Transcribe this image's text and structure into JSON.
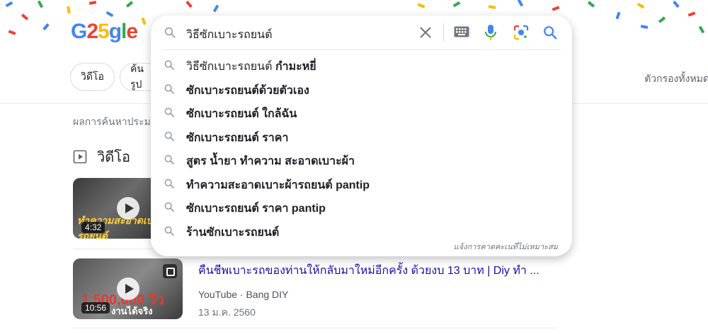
{
  "logo": {
    "text": "G25gle"
  },
  "search": {
    "query": "วิธีซักเบาะรถยนต์",
    "suggestions": [
      {
        "plain": "วิธีซักเบาะรถยนต์ ",
        "bold": "กำมะหยี่"
      },
      {
        "plain": "",
        "bold": "ซักเบาะรถยนต์ด้วยตัวเอง"
      },
      {
        "plain": "",
        "bold": "ซักเบาะรถยนต์ ใกล้ฉัน"
      },
      {
        "plain": "",
        "bold": "ซักเบาะรถยนต์ ราคา"
      },
      {
        "plain": "",
        "bold": "สูตร น้ำยา ทำความ สะอาดเบาะผ้า"
      },
      {
        "plain": "",
        "bold": "ทำความสะอาดเบาะผ้ารถยนต์ pantip"
      },
      {
        "plain": "",
        "bold": "ซักเบาะรถยนต์ ราคา pantip"
      },
      {
        "plain": "",
        "bold": "ร้านซักเบาะรถยนต์"
      }
    ],
    "report_text": "แจ้งการคาดคะเนที่ไม่เหมาะสม"
  },
  "chips": [
    "วิดีโอ",
    "ค้นรูป"
  ],
  "filters_all": "ตัวกรองทั้งหมด",
  "results_info": "ผลการค้นหาประมาณ",
  "video_section": {
    "title": "วิดีโอ"
  },
  "videos": [
    {
      "duration": "4:32",
      "overlay": "ทำความสะอาดเบาะรถยนต์"
    },
    {
      "duration": "10:56",
      "overlay_number": "1,500,000 วิว",
      "overlay_text": "งานได้จริง",
      "title": "คืนชีพเบาะรถของท่านให้กลับมาใหม่อีกครั้ง ด้วยงบ 13 บาท | Diy ทำ ...",
      "source": "YouTube",
      "channel": "Bang DIY",
      "date": "13 ม.ค. 2560"
    }
  ],
  "colors": {
    "blue": "#4285f4",
    "red": "#ea4335",
    "yellow": "#fbbc05",
    "green": "#34a853",
    "link": "#1a0dab"
  },
  "icons": [
    "search-icon",
    "close-icon",
    "keyboard-icon",
    "mic-icon",
    "lens-icon",
    "video-icon",
    "play-icon",
    "kebab-icon"
  ]
}
